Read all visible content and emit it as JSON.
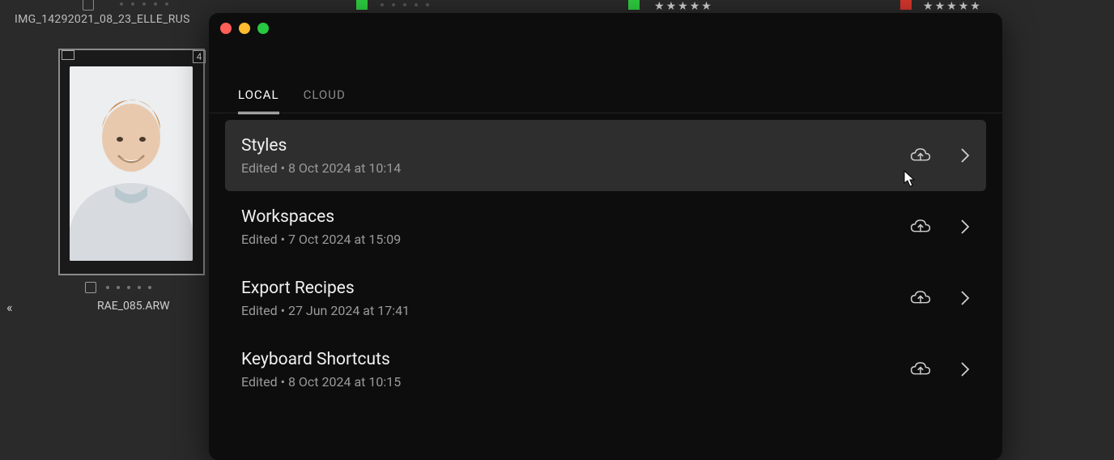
{
  "background": {
    "filename_top": "IMG_14292021_08_23_ELLE_RUS",
    "filename_bottom": "RAE_085.ARW",
    "thumb_number": "4"
  },
  "modal": {
    "tabs": [
      {
        "label": "LOCAL",
        "active": true
      },
      {
        "label": "CLOUD",
        "active": false
      }
    ],
    "items": [
      {
        "title": "Styles",
        "meta_prefix": "Edited",
        "meta_date": "8 Oct 2024 at 10:14",
        "selected": true
      },
      {
        "title": "Workspaces",
        "meta_prefix": "Edited",
        "meta_date": "7 Oct 2024 at 15:09",
        "selected": false
      },
      {
        "title": "Export Recipes",
        "meta_prefix": "Edited",
        "meta_date": "27 Jun 2024 at 17:41",
        "selected": false
      },
      {
        "title": "Keyboard Shortcuts",
        "meta_prefix": "Edited",
        "meta_date": "8 Oct 2024 at 10:15",
        "selected": false
      }
    ]
  }
}
